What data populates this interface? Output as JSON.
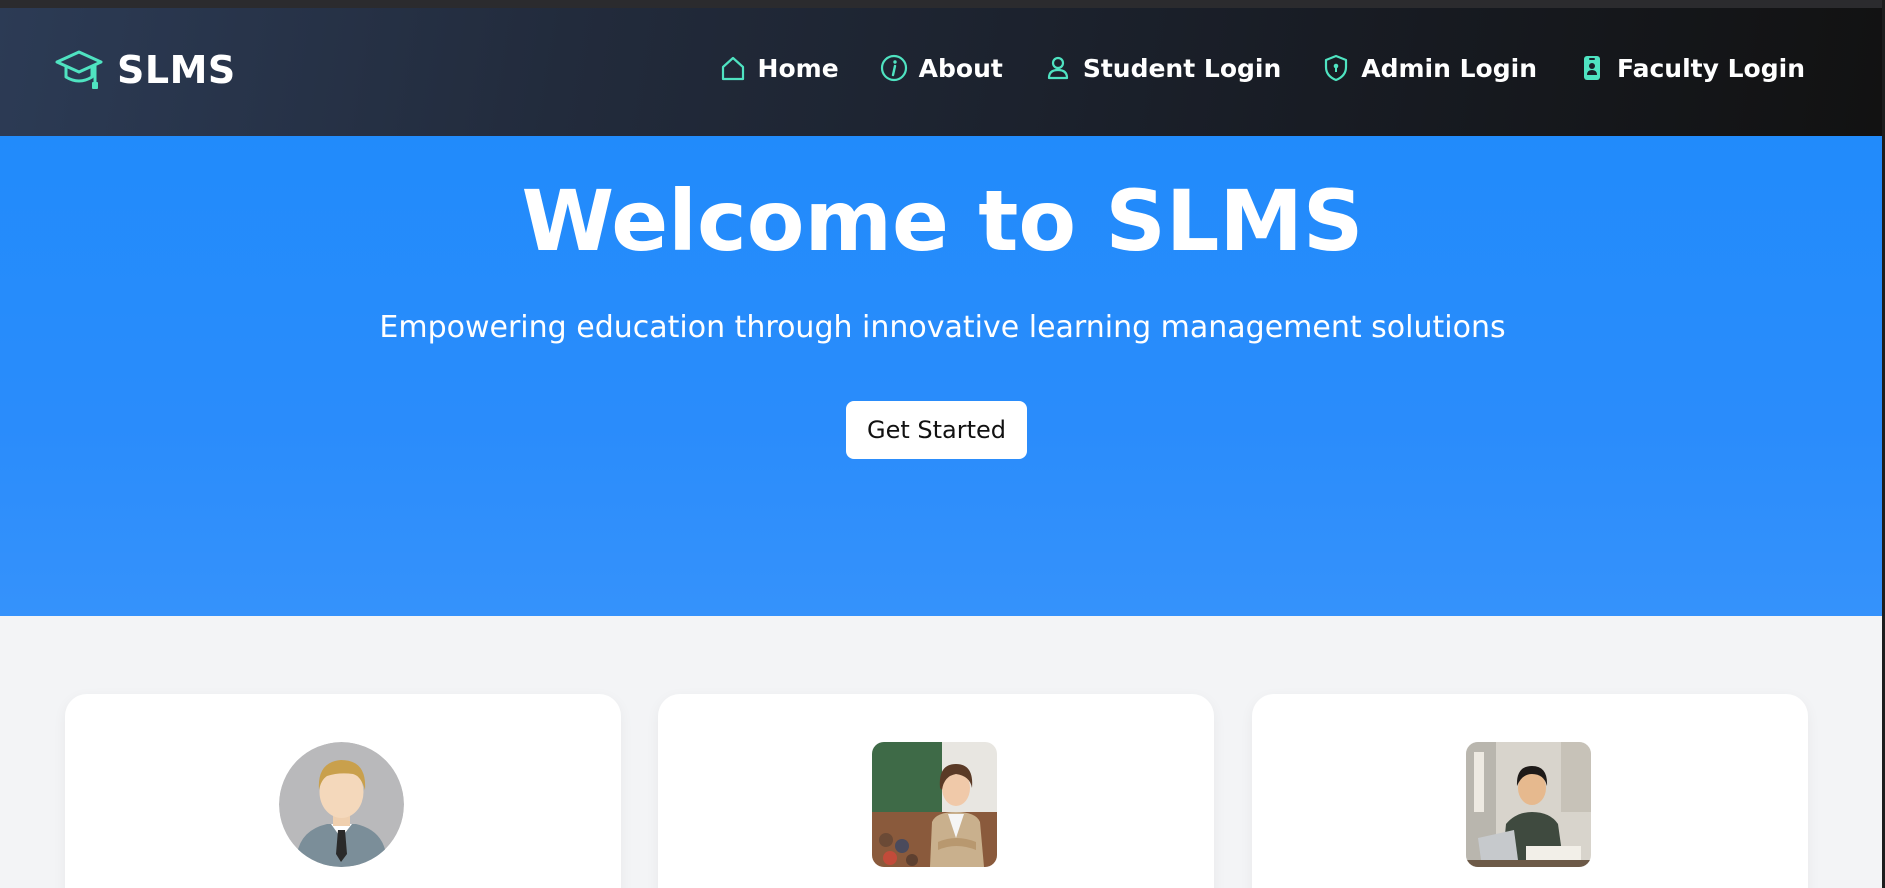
{
  "brand": {
    "name": "SLMS",
    "icon": "graduation-cap-icon"
  },
  "nav": {
    "items": [
      {
        "label": "Home",
        "icon": "home-icon"
      },
      {
        "label": "About",
        "icon": "info-icon"
      },
      {
        "label": "Student Login",
        "icon": "user-icon"
      },
      {
        "label": "Admin Login",
        "icon": "shield-icon"
      },
      {
        "label": "Faculty Login",
        "icon": "id-badge-icon"
      }
    ]
  },
  "hero": {
    "title": "Welcome to SLMS",
    "subtitle": "Empowering education through innovative learning management solutions",
    "cta_label": "Get Started"
  },
  "cards": [
    {
      "image": "admin-avatar"
    },
    {
      "image": "faculty-photo"
    },
    {
      "image": "student-photo"
    }
  ],
  "colors": {
    "accent": "#4fe3c1",
    "hero_blue": "#218bfb",
    "nav_dark": "#181c24"
  }
}
